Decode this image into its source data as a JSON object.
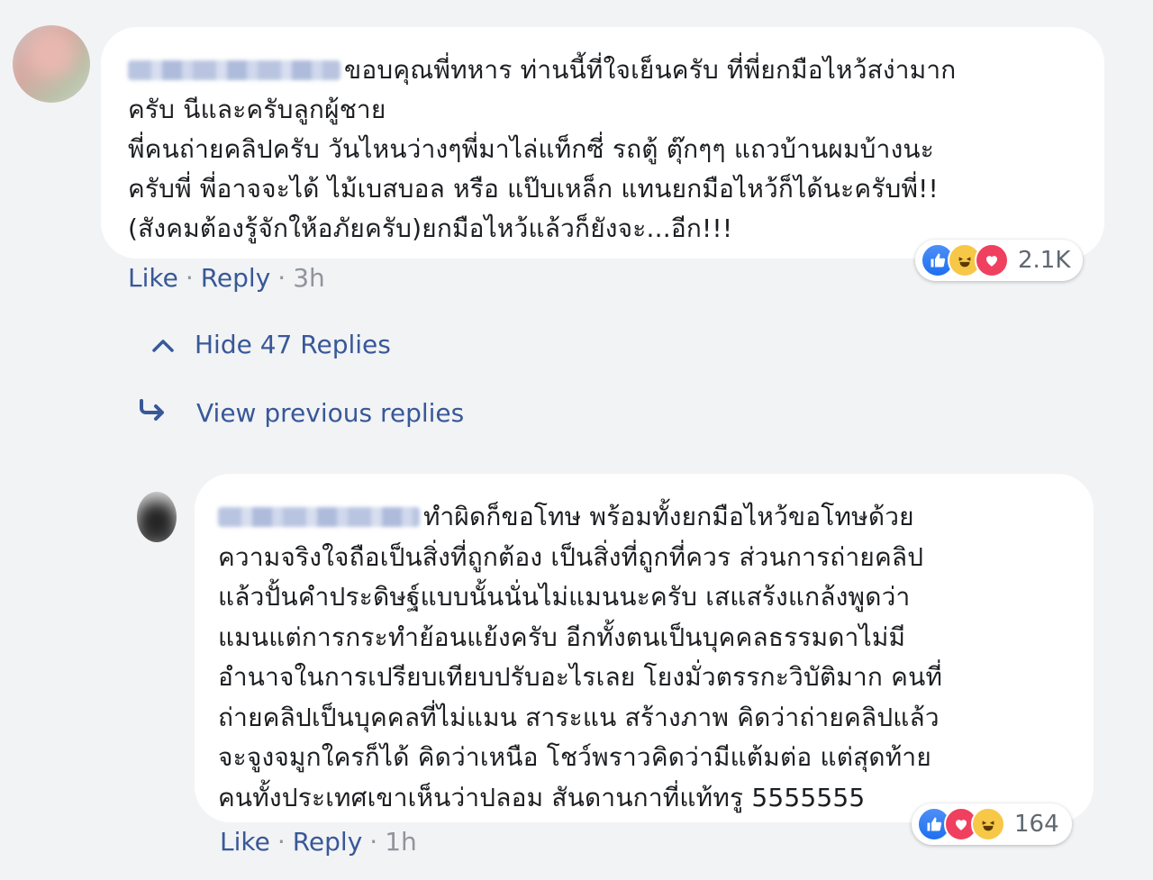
{
  "comment1": {
    "text": "ขอบคุณพี่ทหาร ท่านนี้ที่ใจเย็นครับ ที่พี่ยกมือไหว้สง่ามาก\nครับ นีและครับลูกผู้ชาย\nพี่คนถ่ายคลิปครับ วันไหนว่างๆพี่มาไล่แท็กซี่ รถตู้ ตุ๊กๆๆ แถวบ้านผมบ้างนะ\nครับพี่ พี่อาจจะได้ ไม้เบสบอล หรือ แป๊บเหล็ก แทนยกมือไหว้ก็ได้นะครับพี่!!\n(สังคมต้องรู้จักให้อภัยครับ)ยกมือไหว้แล้วก็ยังจะ...อีก!!!",
    "like_label": "Like",
    "separator": "·",
    "reply_label": "Reply",
    "time": "3h",
    "reaction_count": "2.1K"
  },
  "replies_toggle": {
    "hide_label": "Hide 47 Replies",
    "view_previous_label": "View previous replies"
  },
  "comment2": {
    "text": "ทำผิดก็ขอโทษ พร้อมทั้งยกมือไหว้ขอโทษด้วย\nความจริงใจถือเป็นสิ่งที่ถูกต้อง เป็นสิ่งที่ถูกที่ควร ส่วนการถ่ายคลิป\nแล้วปั้นคำประดิษฐ์แบบนั้นนั่นไม่แมนนะครับ เสแสร้งแกล้งพูดว่า\nแมนแต่การกระทำย้อนแย้งครับ อีกทั้งตนเป็นบุคคลธรรมดาไม่มี\nอำนาจในการเปรียบเทียบปรับอะไรเลย โยงมั่วตรรกะวิบัติมาก คนที่\nถ่ายคลิปเป็นบุคคลที่ไม่แมน สาระแน สร้างภาพ คิดว่าถ่ายคลิปแล้ว\nจะจูงจมูกใครก็ได้ คิดว่าเหนือ โชว์พราวคิดว่ามีแต้มต่อ แต่สุดท้าย\nคนทั้งประเทศเขาเห็นว่าปลอม สันดานกาที่แท้ทรู 5555555",
    "like_label": "Like",
    "separator": "·",
    "reply_label": "Reply",
    "time": "1h",
    "reaction_count": "164"
  },
  "icons": {
    "like": "👍",
    "haha": "😆",
    "love": "♥",
    "chevron_up": "^",
    "reply_arrow": "↪"
  },
  "colors": {
    "background": "#f2f3f5",
    "link": "#385898",
    "meta": "#90949c",
    "like": "#1e6ff0",
    "haha": "#f7c748",
    "love": "#f0405f"
  }
}
